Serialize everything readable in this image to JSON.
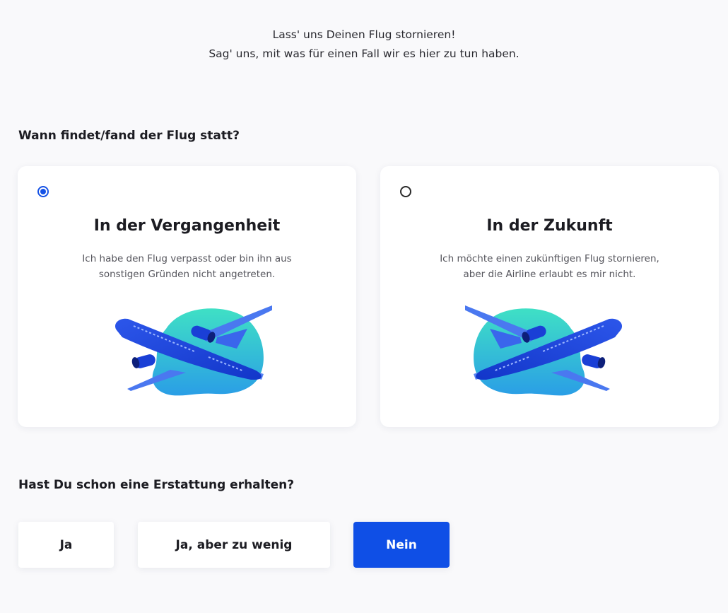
{
  "intro": {
    "line1": "Lass' uns Deinen Flug stornieren!",
    "line2": "Sag' uns, mit was für einen Fall wir es hier zu tun haben."
  },
  "flight_time_question": {
    "heading": "Wann findet/fand der Flug statt?",
    "options": [
      {
        "title": "In der Vergangenheit",
        "desc_line1": "Ich habe den Flug verpasst oder bin ihn aus",
        "desc_line2": "sonstigen Gründen nicht angetreten.",
        "selected": true
      },
      {
        "title": "In der Zukunft",
        "desc_line1": "Ich möchte einen zukünftigen Flug stornieren,",
        "desc_line2": "aber die Airline erlaubt es mir nicht.",
        "selected": false
      }
    ]
  },
  "refund_question": {
    "heading": "Hast Du schon eine Erstattung erhalten?",
    "buttons": {
      "yes": "Ja",
      "yes_too_little": "Ja, aber zu wenig",
      "no": "Nein"
    },
    "selected": "no"
  },
  "colors": {
    "accent": "#0f4fe6",
    "blob_top": "#3fe0c5",
    "blob_bottom": "#2a9ee6",
    "plane_dark": "#1a3fd6",
    "plane_light": "#4a78f0"
  },
  "icons": {
    "card_past_illustration": "airplane-ascending-illustration",
    "card_future_illustration": "airplane-descending-illustration"
  }
}
